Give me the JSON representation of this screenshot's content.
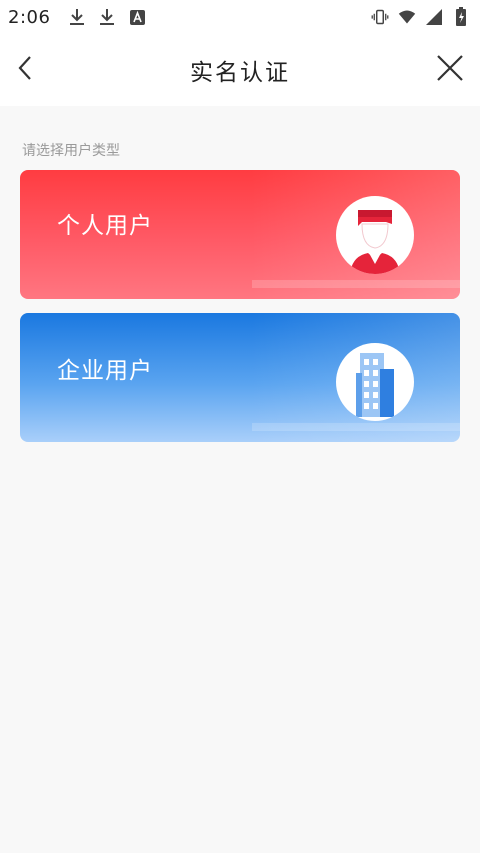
{
  "status_bar": {
    "time": "2:06",
    "left_icons": [
      "download-icon",
      "download-icon",
      "app-notification-icon"
    ],
    "right_icons": [
      "vibrate-icon",
      "wifi-icon",
      "signal-icon",
      "battery-icon"
    ]
  },
  "header": {
    "title": "实名认证",
    "back_icon": "chevron-left-icon",
    "close_icon": "close-icon"
  },
  "main": {
    "section_label": "请选择用户类型",
    "cards": [
      {
        "label": "个人用户",
        "icon": "person-icon",
        "color_top": "#ff3c41",
        "color_bottom": "#ff7681"
      },
      {
        "label": "企业用户",
        "icon": "building-icon",
        "color_top": "#1a78e0",
        "color_bottom": "#a9cffa"
      }
    ]
  },
  "colors": {
    "background": "#f8f8f8",
    "header_bg": "#ffffff",
    "label_gray": "#9a9a9a"
  }
}
